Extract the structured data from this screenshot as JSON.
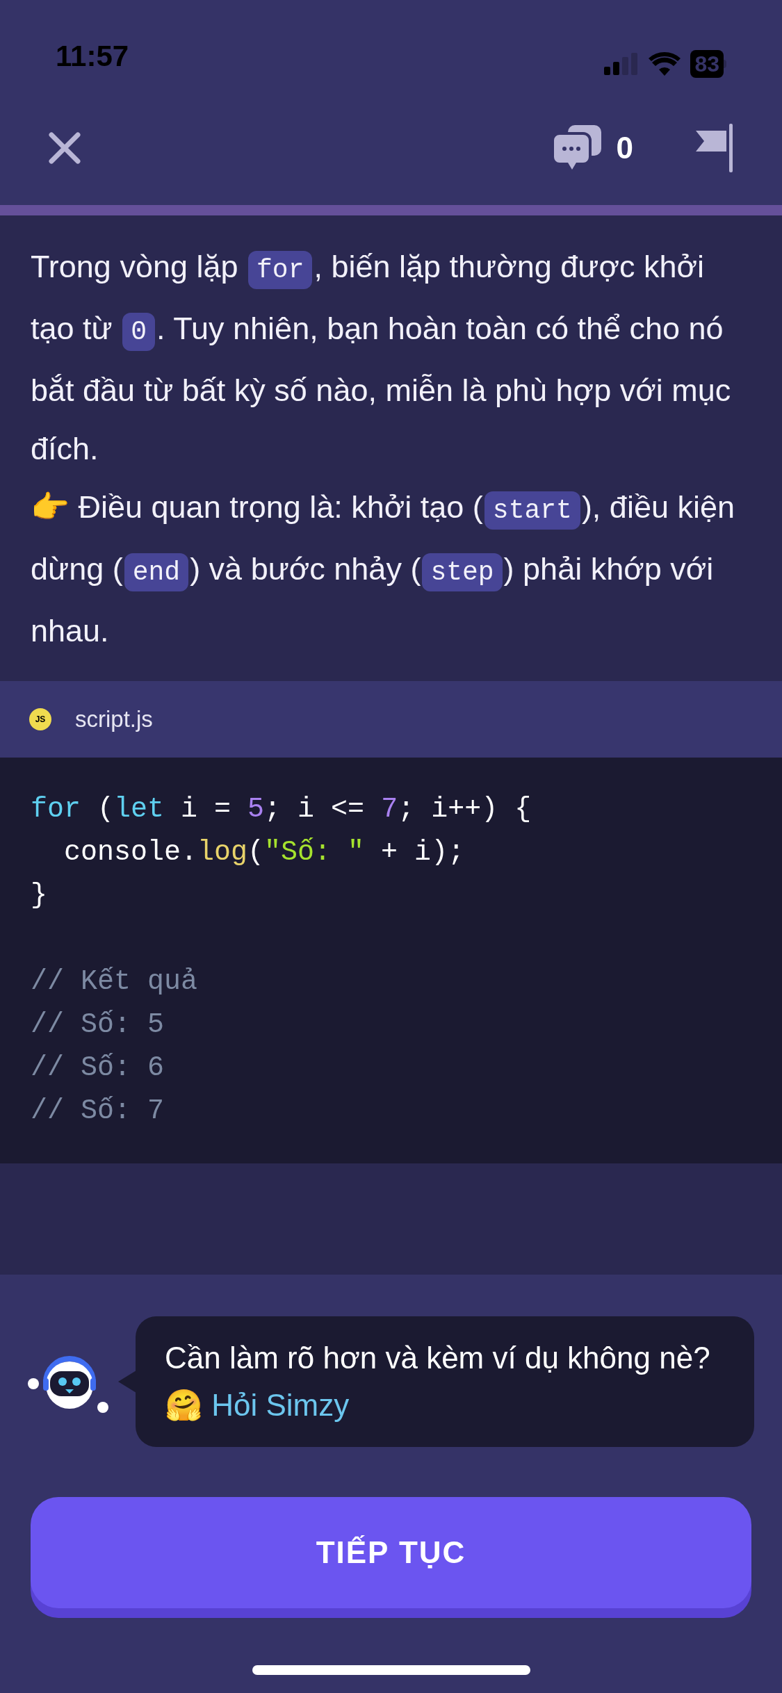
{
  "status_bar": {
    "time": "11:57",
    "battery": "83"
  },
  "header": {
    "comment_count": "0"
  },
  "explanation": [
    [
      {
        "kind": "text",
        "text": "Trong vòng lặp "
      },
      {
        "kind": "code",
        "text": "for"
      },
      {
        "kind": "text",
        "text": ", biến lặp thường được khởi tạo từ "
      },
      {
        "kind": "code",
        "text": "0"
      },
      {
        "kind": "text",
        "text": ". Tuy nhiên, bạn hoàn toàn có thể cho nó bắt đầu từ bất kỳ số nào, miễn là phù hợp với mục đích."
      }
    ],
    [
      {
        "kind": "text",
        "text": "👉 Điều quan trọng là: khởi tạo ("
      },
      {
        "kind": "code",
        "text": "start"
      },
      {
        "kind": "text",
        "text": "), điều kiện dừng ("
      },
      {
        "kind": "code",
        "text": "end"
      },
      {
        "kind": "text",
        "text": ") và bước nhảy ("
      },
      {
        "kind": "code",
        "text": "step"
      },
      {
        "kind": "text",
        "text": ") phải khớp với nhau."
      }
    ]
  ],
  "file": {
    "badge": "JS",
    "name": "script.js"
  },
  "code_blocks": [
    [
      [
        {
          "kind": "keyword",
          "text": "for"
        },
        {
          "kind": "plain",
          "text": " ("
        },
        {
          "kind": "keyword",
          "text": "let"
        },
        {
          "kind": "plain",
          "text": " i = "
        },
        {
          "kind": "number",
          "text": "5"
        },
        {
          "kind": "plain",
          "text": "; i <= "
        },
        {
          "kind": "number",
          "text": "7"
        },
        {
          "kind": "plain",
          "text": "; i++) {"
        }
      ],
      [
        {
          "kind": "plain",
          "text": "  console."
        },
        {
          "kind": "function",
          "text": "log"
        },
        {
          "kind": "plain",
          "text": "("
        },
        {
          "kind": "string",
          "text": "\"Số: \""
        },
        {
          "kind": "plain",
          "text": " + i);"
        }
      ],
      [
        {
          "kind": "plain",
          "text": "}"
        }
      ]
    ],
    [
      [
        {
          "kind": "comment",
          "text": "// Kết quả"
        }
      ],
      [
        {
          "kind": "comment",
          "text": "// Số: 5"
        }
      ],
      [
        {
          "kind": "comment",
          "text": "// Số: 6"
        }
      ],
      [
        {
          "kind": "comment",
          "text": "// Số: 7"
        }
      ]
    ]
  ],
  "assistant": {
    "message": "Cần làm rõ hơn và kèm ví dụ không nè? 🤗",
    "link": "Hỏi Simzy"
  },
  "continue_button": "TIẾP TỤC"
}
